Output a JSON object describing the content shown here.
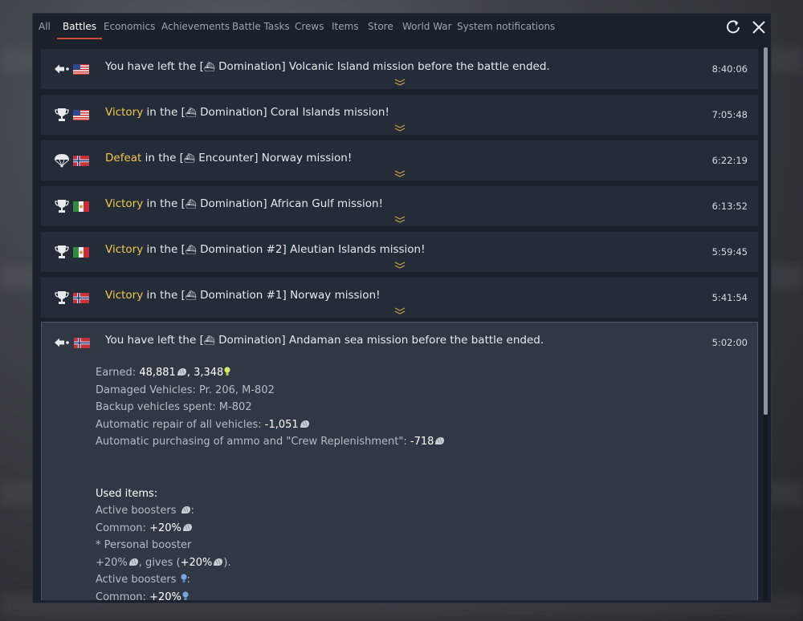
{
  "tabs": [
    "All",
    "Battles",
    "Economics",
    "Achievements",
    "Battle Tasks",
    "Crews",
    "Items",
    "Store",
    "World War",
    "System notifications"
  ],
  "active_tab": "Battles",
  "icons": {
    "refresh": "refresh-icon",
    "close": "close-icon",
    "trophy": "trophy-icon",
    "parachute": "parachute-icon",
    "left-battle": "left-battle-icon",
    "ship": "⛴",
    "silver_lions": "silver-lions-icon",
    "research_points": "research-points-icon",
    "expand": "chevron-down-icon"
  },
  "colors": {
    "highlight": "#f0c850",
    "active_tab_underline": "#d14a3a",
    "research_points": "#d8e86a",
    "blue_bulb": "#7aa4e6"
  },
  "notifications": [
    {
      "icon": "left-battle",
      "flag": "us",
      "highlight": "",
      "text": "You have left the [",
      "mode": " Domination] Volcanic Island mission before the battle ended.",
      "time": "8:40:06"
    },
    {
      "icon": "trophy",
      "flag": "us",
      "highlight": "Victory",
      "text": " in the [",
      "mode": " Domination] Coral Islands mission!",
      "time": "7:05:48"
    },
    {
      "icon": "parachute",
      "flag": "no",
      "highlight": "Defeat",
      "text": " in the [",
      "mode": " Encounter] Norway mission!",
      "time": "6:22:19"
    },
    {
      "icon": "trophy",
      "flag": "it",
      "highlight": "Victory",
      "text": " in the [",
      "mode": " Domination] African Gulf mission!",
      "time": "6:13:52"
    },
    {
      "icon": "trophy",
      "flag": "it",
      "highlight": "Victory",
      "text": " in the [",
      "mode": " Domination #2] Aleutian Islands mission!",
      "time": "5:59:45"
    },
    {
      "icon": "trophy",
      "flag": "no",
      "highlight": "Victory",
      "text": " in the [",
      "mode": " Domination #1] Norway mission!",
      "time": "5:41:54"
    }
  ],
  "expanded": {
    "icon": "left-battle",
    "flag": "no",
    "text": "You have left the [",
    "mode": " Domination] Andaman sea mission before the battle ended.",
    "time": "5:02:00",
    "earned_label": "Earned: ",
    "earned_silver": "48,881",
    "earned_sep": ", ",
    "earned_rp": "3,348",
    "damaged_label": "Damaged Vehicles: ",
    "damaged_value": "Pr. 206, M-802",
    "backup_label": "Backup vehicles spent: ",
    "backup_value": "M-802",
    "repair_label": "Automatic repair of all vehicles: ",
    "repair_value": "-1,051",
    "ammo_label": "Automatic purchasing of ammo and \"Crew Replenishment\": ",
    "ammo_value": "-718",
    "used_items": "Used items:",
    "active_boosters": "Active boosters ",
    "colon": ":",
    "common_label": "Common: ",
    "common_value": "+20%",
    "personal": "* Personal booster",
    "personal_value": "+20%",
    "gives_label": ", gives (",
    "gives_value": "+20%",
    "gives_close": ").",
    "active_boosters2": "Active boosters ",
    "common_label2": "Common: ",
    "common_value2": "+20%"
  }
}
